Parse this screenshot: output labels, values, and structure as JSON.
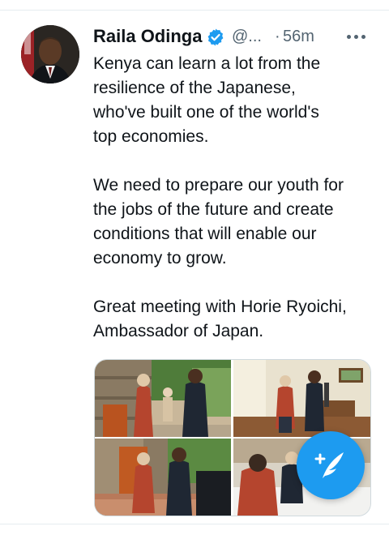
{
  "tweet": {
    "author_name": "Raila Odinga",
    "handle": "@...",
    "separator": "·",
    "timestamp": "56m",
    "paragraphs": [
      [
        "Kenya can learn a lot from the",
        "resilience of the Japanese,",
        "who've built one of the world's",
        "top economies."
      ],
      [
        "We need to prepare our youth for",
        "the jobs of the future and create",
        "conditions that will enable our",
        "economy to grow."
      ],
      [
        "Great meeting with Horie Ryoichi,",
        "Ambassador of Japan."
      ]
    ],
    "media_count": 4
  },
  "icons": {
    "verified": "verified-badge-icon",
    "more": "more-options-icon",
    "compose": "compose-tweet-icon"
  },
  "colors": {
    "accent": "#1d9bf0",
    "text": "#0f1419",
    "secondary": "#536471"
  }
}
